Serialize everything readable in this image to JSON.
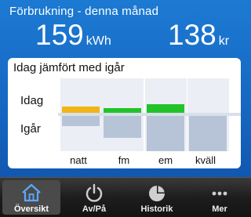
{
  "header": {
    "title": "Förbrukning - denna månad",
    "energy": {
      "value": "159",
      "unit": "kWh"
    },
    "cost": {
      "value": "138",
      "unit": "kr"
    }
  },
  "comparison": {
    "title": "Idag jämfört med igår",
    "today_label": "Idag",
    "yesterday_label": "Igår",
    "periods": [
      "natt",
      "fm",
      "em",
      "kväll"
    ],
    "today_levels": [
      0.38,
      0.28,
      0.55,
      0
    ],
    "today_colors": [
      "#f1b418",
      "#22c32a",
      "#22c32a",
      "#22c32a"
    ],
    "yesterday_levels": [
      0.28,
      0.62,
      1.0,
      1.0
    ],
    "yesterday_color": "#b7c4d8"
  },
  "tabbar": {
    "items": [
      {
        "label": "Översikt",
        "icon": "home-icon",
        "active": true
      },
      {
        "label": "Av/På",
        "icon": "power-icon",
        "active": false
      },
      {
        "label": "Historik",
        "icon": "pie-chart-icon",
        "active": false
      },
      {
        "label": "Mer",
        "icon": "more-icon",
        "active": false
      }
    ]
  }
}
